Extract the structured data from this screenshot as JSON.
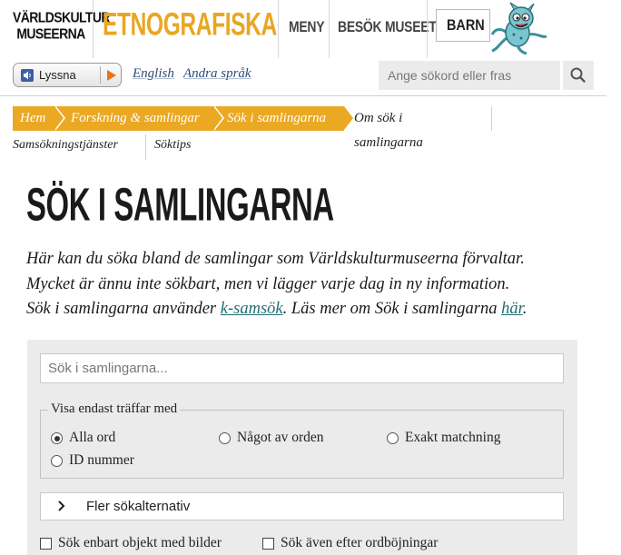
{
  "header": {
    "logo_vk_line1": "VÄRLDSKULTUR",
    "logo_vk_line2": "MUSEERNA",
    "logo_etno": "ETNOGRAFISKA",
    "nav": [
      {
        "label": "MENY"
      },
      {
        "label": "BESÖK MUSEET"
      }
    ],
    "barn_label": "BARN",
    "brand_color": "#e8a723"
  },
  "toolbar": {
    "listen_label": "Lyssna",
    "languages": [
      {
        "label": "English"
      },
      {
        "label": "Andra språk"
      }
    ],
    "search_placeholder": "Ange sökord eller fras",
    "search_icon": "magnifier-icon"
  },
  "breadcrumb": {
    "items": [
      {
        "label": "Hem"
      },
      {
        "label": "Forskning & samlingar"
      },
      {
        "label": "Sök i samlingarna"
      }
    ],
    "current": "Om sök i samlingarna"
  },
  "subnav": {
    "items": [
      {
        "label": "Samsökningstjänster"
      },
      {
        "label": "Söktips"
      }
    ]
  },
  "main": {
    "title": "SÖK I SAMLINGARNA",
    "intro_line1": "Här kan du söka bland de samlingar som Världskulturmuseerna förvaltar.",
    "intro_line2": "Mycket är ännu inte sökbart, men vi lägger varje dag in ny information.",
    "intro_line3_a": "Sök i samlingarna använder ",
    "intro_link1": "k-samsök",
    "intro_line3_b": ". Läs mer om Sök i samlingarna ",
    "intro_link2": "här",
    "intro_line3_c": "."
  },
  "search_panel": {
    "placeholder": "Sök i samlingarna...",
    "filter_legend": "Visa endast träffar med",
    "radio_options": [
      {
        "label": "Alla ord",
        "selected": true
      },
      {
        "label": "Något av orden",
        "selected": false
      },
      {
        "label": "Exakt matchning",
        "selected": false
      },
      {
        "label": "ID nummer",
        "selected": false
      }
    ],
    "more_options_label": "Fler sökalternativ",
    "checkboxes": [
      {
        "label": "Sök enbart objekt med bilder",
        "checked": false
      },
      {
        "label": "Sök även efter ordböjningar",
        "checked": false
      }
    ]
  }
}
